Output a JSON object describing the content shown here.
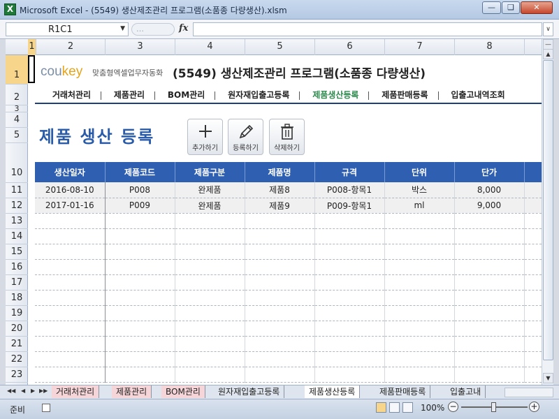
{
  "window": {
    "title": "Microsoft Excel - (5549) 생산제조관리 프로그램(소품종 다량생산).xlsm",
    "app_icon": "X"
  },
  "formula_bar": {
    "name_box": "R1C1",
    "fx": "fx",
    "formula": ""
  },
  "columns": [
    "1",
    "2",
    "3",
    "4",
    "5",
    "6",
    "7",
    "8"
  ],
  "rows": [
    "1",
    "2",
    "3",
    "4",
    "5",
    "10",
    "11",
    "12",
    "13",
    "14",
    "15",
    "16",
    "17",
    "18",
    "19",
    "20",
    "21",
    "22",
    "23"
  ],
  "branding": {
    "logo_main": "cou",
    "logo_accent": "key",
    "logo_sub": "맞춤형엑셀업무자동화",
    "program_title": "(5549) 생산제조관리 프로그램(소품종 다량생산)"
  },
  "nav": {
    "items": [
      {
        "label": "거래처관리",
        "active": false
      },
      {
        "label": "제품관리",
        "active": false
      },
      {
        "label": "BOM관리",
        "active": false
      },
      {
        "label": "원자재입출고등록",
        "active": false
      },
      {
        "label": "제품생산등록",
        "active": true
      },
      {
        "label": "제품판매등록",
        "active": false
      },
      {
        "label": "입출고내역조회",
        "active": false
      }
    ]
  },
  "page": {
    "title": "제품 생산 등록"
  },
  "toolbar": {
    "add_label": "추가하기",
    "register_label": "등록하기",
    "delete_label": "삭제하기"
  },
  "table": {
    "headers": [
      "생산일자",
      "제품코드",
      "제품구분",
      "제품명",
      "규격",
      "단위",
      "단가"
    ],
    "rows": [
      [
        "2016-08-10",
        "P008",
        "완제품",
        "제품8",
        "P008-항목1",
        "박스",
        "8,000"
      ],
      [
        "2017-01-16",
        "P009",
        "완제품",
        "제품9",
        "P009-항목1",
        "ml",
        "9,000"
      ]
    ],
    "empty_rows": 11
  },
  "sheet_tabs": [
    {
      "label": "거래처관리",
      "active": false
    },
    {
      "label": "제품관리",
      "active": false
    },
    {
      "label": "BOM관리",
      "active": false
    },
    {
      "label": "원자재입출고등록",
      "active": false
    },
    {
      "label": "제품생산등록",
      "active": true
    },
    {
      "label": "제품판매등록",
      "active": false
    },
    {
      "label": "입출고내",
      "active": false
    }
  ],
  "status": {
    "ready": "준비",
    "zoom": "100%"
  },
  "colors": {
    "accent_blue": "#2f5fb0",
    "title_blue": "#2a5ba9",
    "active_green": "#2d8a4d",
    "logo_orange": "#e4a41c"
  }
}
